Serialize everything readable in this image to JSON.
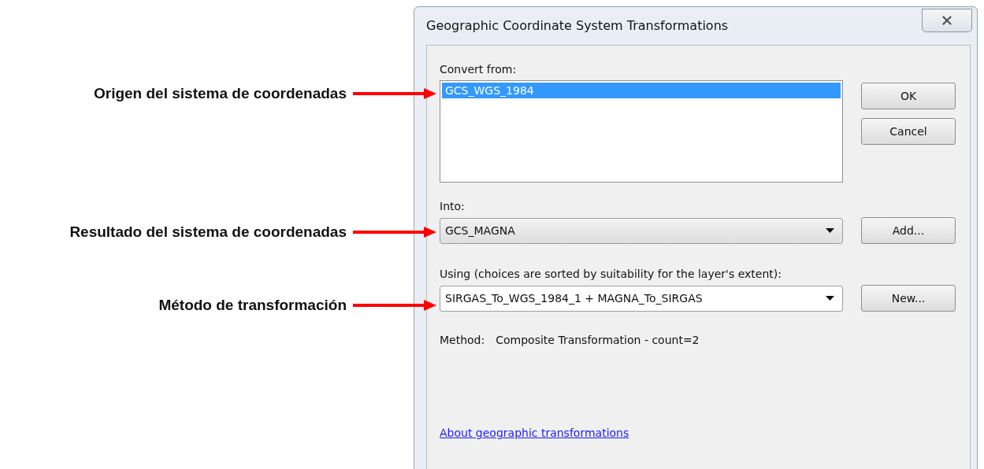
{
  "annotations": [
    {
      "text": "Origen del sistema de coordenadas"
    },
    {
      "text": "Resultado del sistema de coordenadas"
    },
    {
      "text": "Método de transformación"
    }
  ],
  "dialog": {
    "title": "Geographic Coordinate System Transformations",
    "convert_from": {
      "label": "Convert from:",
      "items": [
        {
          "text": "GCS_WGS_1984",
          "selected": true
        }
      ],
      "buttons": [
        "OK",
        "Cancel"
      ]
    },
    "into": {
      "label": "Into:",
      "value": "GCS_MAGNA",
      "button": "Add..."
    },
    "using": {
      "label": "Using (choices are sorted by suitability for the layer's extent):",
      "value": "SIRGAS_To_WGS_1984_1 + MAGNA_To_SIRGAS",
      "button": "New..."
    },
    "method": {
      "label": "Method:",
      "value": "Composite Transformation - count=2"
    },
    "link": "About geographic transformations"
  }
}
